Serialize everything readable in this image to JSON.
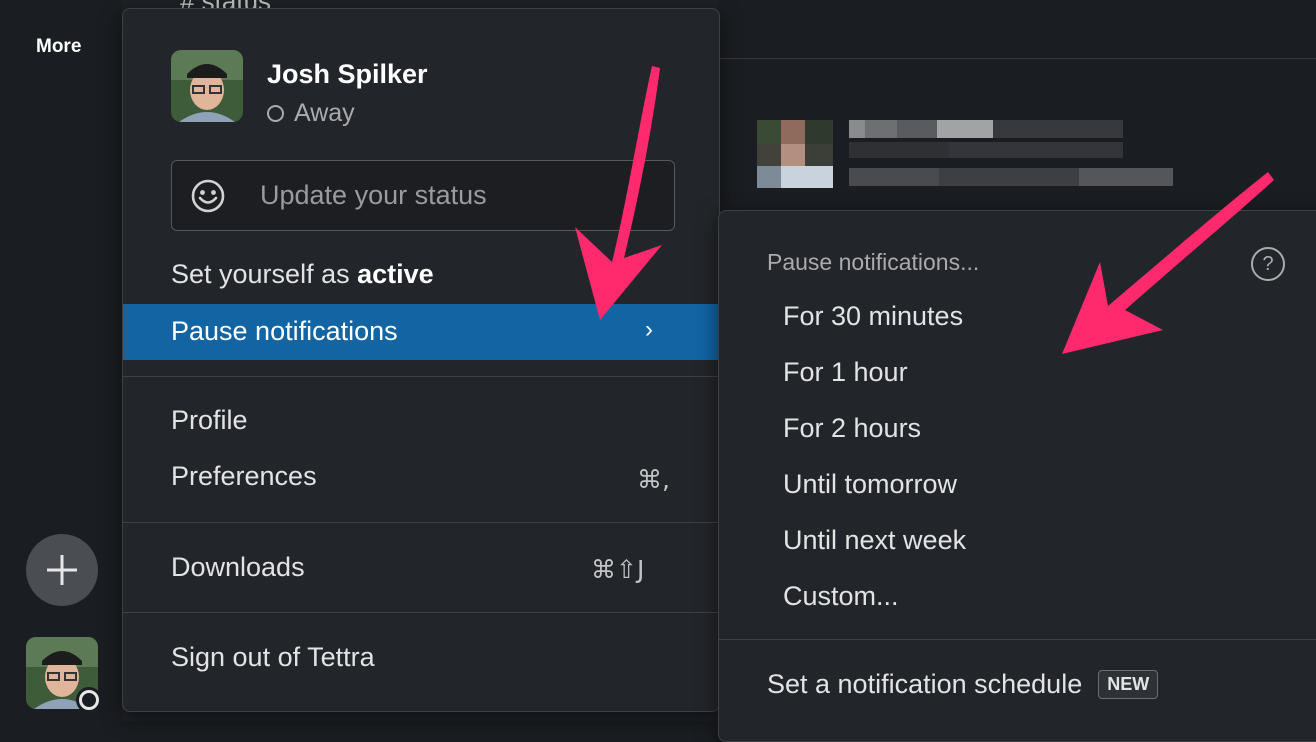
{
  "sidebar": {
    "more_label": "More"
  },
  "channel": {
    "peek_text": "#   status"
  },
  "user_menu": {
    "name": "Josh Spilker",
    "presence": "Away",
    "status_placeholder": "Update your status",
    "set_active_prefix": "Set yourself as ",
    "set_active_bold": "active",
    "pause_label": "Pause notifications",
    "pause_chevron": "›",
    "profile_label": "Profile",
    "preferences_label": "Preferences",
    "preferences_shortcut": "⌘,",
    "downloads_label": "Downloads",
    "downloads_shortcut": "⌘⇧J",
    "signout_label": "Sign out of Tettra"
  },
  "pause_submenu": {
    "header": "Pause notifications...",
    "help_glyph": "?",
    "items": [
      "For 30 minutes",
      "For 1 hour",
      "For 2 hours",
      "Until tomorrow",
      "Until next week",
      "Custom..."
    ],
    "schedule_label": "Set a notification schedule",
    "schedule_badge": "NEW"
  },
  "colors": {
    "highlight": "#1264a3",
    "annotation_arrow": "#ff2a6d",
    "background": "#1a1d21",
    "menu_bg": "#222529"
  },
  "icons": [
    "plus-icon",
    "smile-icon",
    "chevron-right-icon",
    "help-icon",
    "avatar"
  ]
}
